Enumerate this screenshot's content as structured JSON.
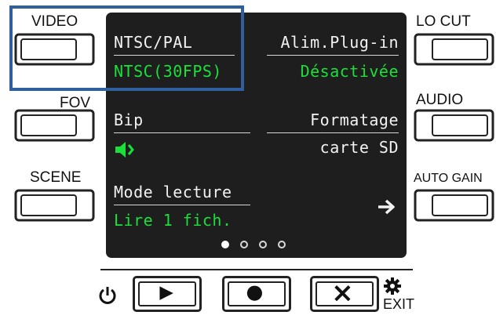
{
  "left_buttons": [
    {
      "label": "VIDEO"
    },
    {
      "label": "FOV"
    },
    {
      "label": "SCENE"
    }
  ],
  "right_buttons": [
    {
      "label": "LO CUT"
    },
    {
      "label": "AUDIO"
    },
    {
      "label": "AUTO GAIN"
    }
  ],
  "screen": {
    "ntsc_pal": {
      "title": "NTSC/PAL",
      "value": "NTSC(30FPS)"
    },
    "plugin": {
      "title": "Alim.Plug-in",
      "value": "Désactivée"
    },
    "bip": {
      "title": "Bip",
      "icon": "speaker-icon"
    },
    "formatage": {
      "title": "Formatage",
      "value": "carte SD"
    },
    "mode_lecture": {
      "title": "Mode lecture",
      "value": "Lire 1 fich."
    },
    "next_icon": "arrow-right-icon",
    "pagination": {
      "total": 4,
      "current": 1
    }
  },
  "controls": {
    "power_icon": "power-icon",
    "play_icon": "play-icon",
    "record_icon": "record-icon",
    "cancel_icon": "close-icon",
    "settings_icon": "gear-icon",
    "exit_label": "EXIT"
  },
  "colors": {
    "screen_bg": "#1e1e1e",
    "lcd_text": "#f2f2f2",
    "lcd_green": "#19e13a",
    "highlight_border": "#2f5f9e"
  }
}
